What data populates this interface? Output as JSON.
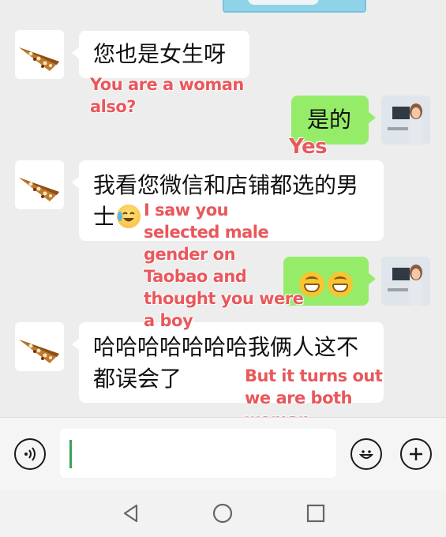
{
  "messages": [
    {
      "id": "msg1",
      "side": "left",
      "text": "您也是女生呀"
    },
    {
      "id": "msg2",
      "side": "right",
      "text": "是的"
    },
    {
      "id": "msg3",
      "side": "left",
      "text": "我看您微信和店铺都选的男士"
    },
    {
      "id": "msg4",
      "side": "right",
      "text": "😁😁"
    },
    {
      "id": "msg5",
      "side": "left",
      "text": "哈哈哈哈哈哈哈我俩人这不都误会了"
    }
  ],
  "annotations": {
    "a1": "You are a woman\nalso?",
    "a2": "Yes",
    "a3": "I saw you\nselected male\ngender on\nTaobao and\nthought you were\na boy",
    "a4": "But it turns out\nwe are both\nwoman."
  },
  "input_bar": {
    "value": ""
  },
  "icons": {
    "voice": "voice-icon",
    "emoji": "emoji-icon",
    "more": "plus-icon",
    "back": "back-triangle-icon",
    "home": "home-circle-icon",
    "recents": "recents-square-icon"
  },
  "colors": {
    "outgoing_bubble": "#95ec69",
    "incoming_bubble": "#ffffff",
    "annotation": "#e8585c",
    "chat_bg": "#ededed"
  }
}
